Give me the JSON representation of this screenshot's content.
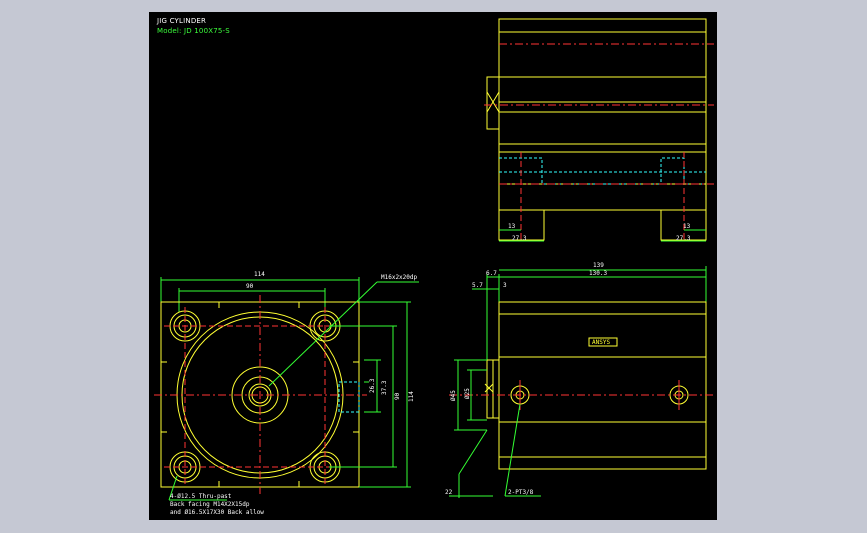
{
  "drawing": {
    "title": "JIG CYLINDER",
    "model": "Model: JD 100X75-S"
  },
  "colors": {
    "background": "#000000",
    "frame": "#c5c8d3",
    "outline": "#ffff33",
    "centerline": "#ff3333",
    "dimension": "#33ff33",
    "hidden": "#33ffff",
    "label": "#ffffff"
  },
  "front_view": {
    "dims": {
      "width": "114",
      "bolt_pitch": "90",
      "thread": "M16x2x20dp",
      "dim_263": "26.3",
      "dim_373": "37.3",
      "dim_90v": "90",
      "dim_114v": "114"
    },
    "note": [
      "4-Ø12.5 Thru-past",
      "Back facing M14X2X15dp",
      "and Ø16.5X17X30 Back allow"
    ]
  },
  "side_view": {
    "dims": {
      "length": "139",
      "body": "130.3",
      "d67": "6.7",
      "d57": "5.7",
      "d3": "3",
      "rod": "Ø25",
      "bore": "Ø45",
      "d22": "22",
      "ports": "2-PT3/8"
    },
    "logo": "ANSYS"
  },
  "top_view": {
    "dims": {
      "left_13": "13",
      "left_273": "27.3",
      "right_13": "13",
      "right_273": "27.3"
    }
  }
}
